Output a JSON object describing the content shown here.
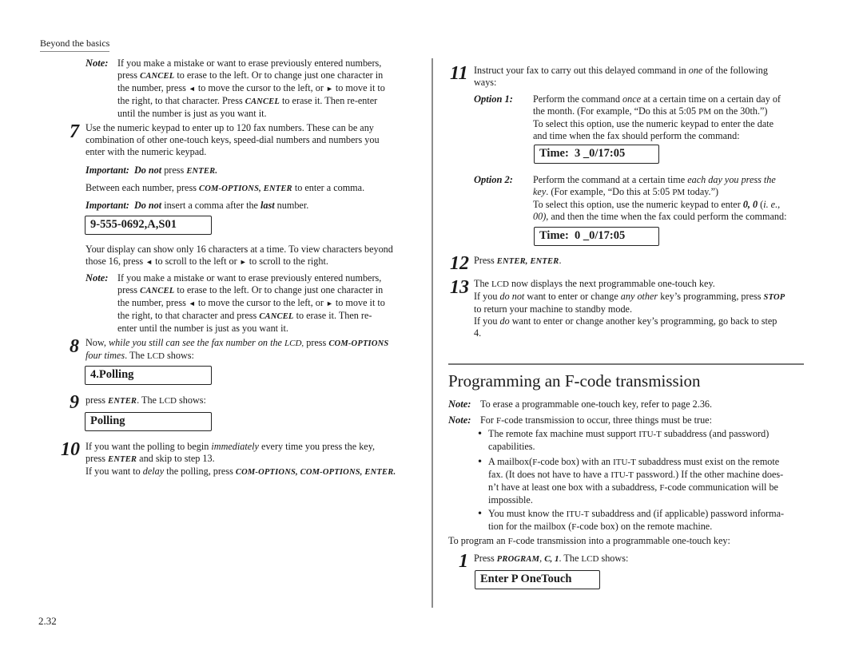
{
  "running_head": "Beyond the basics",
  "page_number": "2.32",
  "left": {
    "note1": {
      "label": "Note:",
      "l1": "If you make a mistake or want to erase previously entered numbers,",
      "l2a": "press ",
      "l2k": "CANCEL",
      "l2b": " to erase to the left. Or to change just one character in",
      "l3a": "the number, press ",
      "l3b": " to move the cursor to the left, or ",
      "l3c": " to move it to",
      "l4a": "the right, to that character. Press ",
      "l4k": "CANCEL",
      "l4b": " to erase it. Then re-enter",
      "l5": "until the number is just as you want it."
    },
    "step7": {
      "num": "7",
      "l1": "Use the numeric keypad to enter up to 120 fax numbers. These can be any",
      "l2": "combination of other one-touch keys, speed-dial numbers and numbers you",
      "l3": "enter with the numeric keypad.",
      "imp1_label": "Important:",
      "imp1_bold": "Do not",
      "imp1_text": " press ",
      "imp1_key": "ENTER.",
      "between_a": "Between each number, press ",
      "between_k": "COM-OPTIONS, ENTER",
      "between_b": " to enter a comma.",
      "imp2_label": "Important:",
      "imp2_bold": "Do not",
      "imp2_text": " insert a comma after the ",
      "imp2_last": "last",
      "imp2_end": " number.",
      "lcd": "9-555-0692,A,S01",
      "disp_l1": "Your display can show only 16 characters at a time. To view characters beyond",
      "disp_l2a": "those 16, press ",
      "disp_l2b": " to scroll to the left or ",
      "disp_l2c": " to scroll to the right."
    },
    "note2": {
      "label": "Note:",
      "l1": "If you make a mistake or want to erase previously entered numbers,",
      "l2a": "press ",
      "l2k": "CANCEL",
      "l2b": " to erase to the left. Or to change just one character in",
      "l3a": "the number, press ",
      "l3b": " to move the cursor to the left, or ",
      "l3c": " to move it to",
      "l4a": "the right, to that character and press ",
      "l4k": "CANCEL",
      "l4b": " to erase it. Then re-",
      "l5": "enter until the number is just as you want it."
    },
    "step8": {
      "num": "8",
      "l1a": "Now, ",
      "l1i": "while you still can see the fax number on the ",
      "l1sc": "LCD,",
      "l1b": " press ",
      "l1k": "COM-OPTIONS",
      "l2i": "four times",
      "l2a": ". The ",
      "l2sc": "LCD",
      "l2b": " shows:",
      "lcd": "4.Polling"
    },
    "step9": {
      "num": "9",
      "l1a": "press ",
      "l1k": "ENTER",
      "l1b": ". The ",
      "l1sc": "LCD",
      "l1c": " shows:",
      "lcd": "Polling"
    },
    "step10": {
      "num": "10",
      "l1a": "If you want the polling to begin ",
      "l1i": "immediately",
      "l1b": " every time you press the key,",
      "l2a": "press ",
      "l2k": "ENTER",
      "l2b": " and skip to step 13.",
      "l3a": "If you want to ",
      "l3i": "delay",
      "l3b": " the polling, press ",
      "l3k": "COM-OPTIONS, COM-OPTIONS, ENTER."
    }
  },
  "right": {
    "step11": {
      "num": "11",
      "l1a": "Instruct your fax to carry out this delayed command in ",
      "l1i": "one",
      "l1b": " of the following",
      "l2": "ways:",
      "opt1": {
        "label": "Option 1:",
        "l1a": "Perform the command ",
        "l1i": "once",
        "l1b": " at a certain time on a certain day of",
        "l2a": "the month. (For example, “Do this at 5:05 ",
        "l2sc": "PM",
        "l2b": " on the 30th.”)",
        "l3": "To select this option, use the numeric keypad to enter the date",
        "l4": "and time when the fax should perform the command:",
        "lcd": "Time:  3 _0/17:05"
      },
      "opt2": {
        "label": "Option 2:",
        "l1a": "Perform the command at a certain time ",
        "l1i": "each day you press the",
        "l2i": "key",
        "l2a": ". (For example, “Do this at 5:05 ",
        "l2sc": "PM",
        "l2b": " today.”)",
        "l3a": "To select this option, use the numeric keypad to enter ",
        "l3b": "0, 0",
        "l3c": " (",
        "l3i": "i. e.,",
        "l4i": "00),",
        "l4a": " and then the time when the fax could perform the command:",
        "lcd": "Time:  0 _0/17:05"
      }
    },
    "step12": {
      "num": "12",
      "l1a": "Press ",
      "l1k": "ENTER, ENTER",
      "l1b": "."
    },
    "step13": {
      "num": "13",
      "l1a": "The ",
      "l1sc": "LCD",
      "l1b": " now displays the next programmable one-touch key.",
      "l2a": "If you ",
      "l2i": "do not",
      "l2b": " want to enter or change ",
      "l2i2": "any other",
      "l2c": " key’s programming, press ",
      "l2k": "STOP",
      "l3": "to return your machine to standby mode.",
      "l4a": "If you ",
      "l4i": "do",
      "l4b": " want to enter or change another key’s programming, go back to step",
      "l5": "4."
    },
    "section": {
      "title_a": "Programming an ",
      "title_sc": "F",
      "title_b": "-code transmission",
      "note1_label": "Note:",
      "note1_text": "To erase a programmable one-touch key, refer to page 2.36.",
      "note2_label": "Note:",
      "note2_a": "For ",
      "note2_sc": "F",
      "note2_b": "-code transmission to occur, three things must be true:",
      "bullet_glyph": "•",
      "b1_l1a": "The remote fax machine must support ",
      "b1_l1sc": "ITU-T",
      "b1_l1b": " subaddress (and password)",
      "b1_l2": "capabilities.",
      "b2_l1a": "A mailbox(",
      "b2_l1sc": "F",
      "b2_l1b": "-code box) with an ",
      "b2_l1sc2": "ITU-T",
      "b2_l1c": " subaddress must exist on the remote",
      "b2_l2a": "fax. (It does not have to have a ",
      "b2_l2sc": "ITU-T",
      "b2_l2b": " password.)  If the other machine does-",
      "b2_l3a": "n’t have at least one box with a subaddress, ",
      "b2_l3sc": "F",
      "b2_l3b": "-code communication will be",
      "b2_l4": "impossible.",
      "b3_l1a": "You must know the ",
      "b3_l1sc": "ITU-T",
      "b3_l1b": " subaddress and (if applicable) password informa-",
      "b3_l2a": "tion for the mailbox (",
      "b3_l2sc": "F",
      "b3_l2b": "-code box) on the remote machine.",
      "program_a": "To program an ",
      "program_sc": "F",
      "program_b": "-code transmission into a programmable one-touch key:"
    },
    "step1": {
      "num": "1",
      "l1a": "Press ",
      "l1k": "PROGRAM",
      "l1b": ", ",
      "l1i": "C, 1",
      "l1c": ". The ",
      "l1sc": "LCD",
      "l1d": " shows:",
      "lcd": "Enter P OneTouch"
    }
  },
  "icons": {
    "left_arrow": "◄",
    "right_arrow": "►"
  }
}
